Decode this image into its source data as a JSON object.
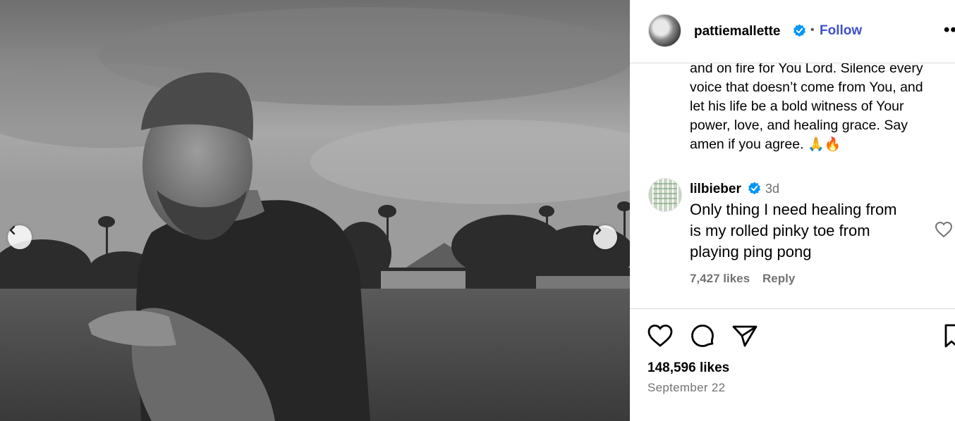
{
  "post": {
    "author": {
      "username": "pattiemallette",
      "follow_label": "Follow",
      "separator": "•",
      "more_label": "••"
    },
    "caption": {
      "lines": [
        "and on fire for You Lord. Silence every",
        "voice that doesn’t come from You, and",
        "let his life be a bold witness of Your",
        "power, love, and healing grace. Say",
        "amen if you agree."
      ],
      "emoji": "🙏🔥"
    },
    "comment": {
      "username": "lilbieber",
      "time": "3d",
      "text_lines": [
        "Only thing I need healing from",
        "is my rolled pinky toe from",
        "playing ping pong"
      ],
      "likes": "7,427 likes",
      "reply_label": "Reply"
    },
    "actions": [
      "heart-icon",
      "comment-icon",
      "share-icon",
      "save-icon"
    ],
    "likes": "148,596 likes",
    "date": "September 22"
  },
  "media": {
    "description_icons": [
      "chevron-left-icon",
      "chevron-right-icon"
    ]
  },
  "colors": {
    "follow": "#3f50c8",
    "verified": "#0095f6",
    "muted": "#737373"
  }
}
